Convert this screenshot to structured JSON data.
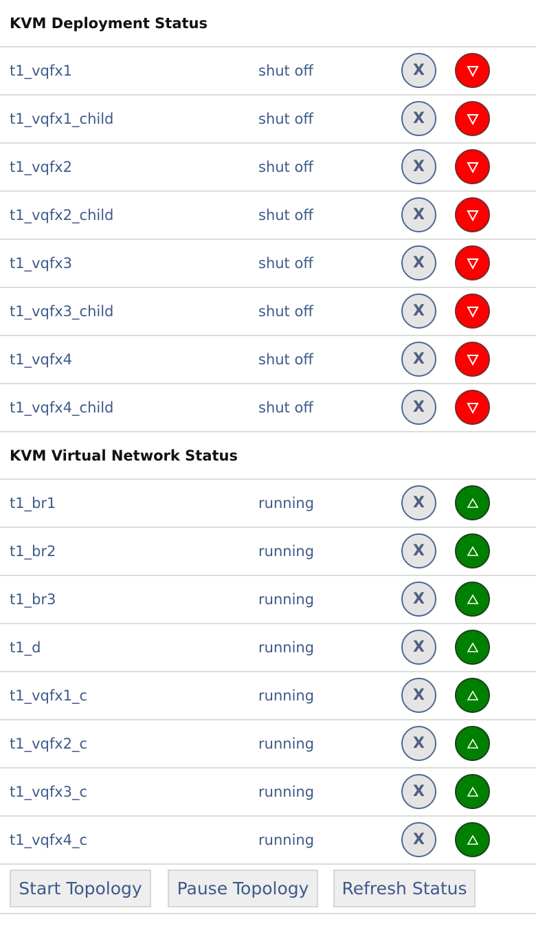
{
  "deployment": {
    "title": "KVM Deployment Status",
    "rows": [
      {
        "name": "t1_vqfx1",
        "status": "shut off"
      },
      {
        "name": "t1_vqfx1_child",
        "status": "shut off"
      },
      {
        "name": "t1_vqfx2",
        "status": "shut off"
      },
      {
        "name": "t1_vqfx2_child",
        "status": "shut off"
      },
      {
        "name": "t1_vqfx3",
        "status": "shut off"
      },
      {
        "name": "t1_vqfx3_child",
        "status": "shut off"
      },
      {
        "name": "t1_vqfx4",
        "status": "shut off"
      },
      {
        "name": "t1_vqfx4_child",
        "status": "shut off"
      }
    ],
    "state_color": "#ff0000"
  },
  "network": {
    "title": "KVM Virtual Network Status",
    "rows": [
      {
        "name": "t1_br1",
        "status": "running"
      },
      {
        "name": "t1_br2",
        "status": "running"
      },
      {
        "name": "t1_br3",
        "status": "running"
      },
      {
        "name": "t1_d",
        "status": "running"
      },
      {
        "name": "t1_vqfx1_c",
        "status": "running"
      },
      {
        "name": "t1_vqfx2_c",
        "status": "running"
      },
      {
        "name": "t1_vqfx3_c",
        "status": "running"
      },
      {
        "name": "t1_vqfx4_c",
        "status": "running"
      }
    ],
    "state_color": "#008000"
  },
  "row_buttons": {
    "remove_label": "X",
    "remove_icon": "close-icon",
    "stop_icon": "triangle-down-icon",
    "start_icon": "triangle-up-icon"
  },
  "actions": {
    "start_label": "Start Topology",
    "pause_label": "Pause Topology",
    "refresh_label": "Refresh Status"
  },
  "colors": {
    "link_text": "#3d5a8a",
    "heading_text": "#111111",
    "divider": "#dcdcdc",
    "button_bg": "#eeeeee"
  }
}
